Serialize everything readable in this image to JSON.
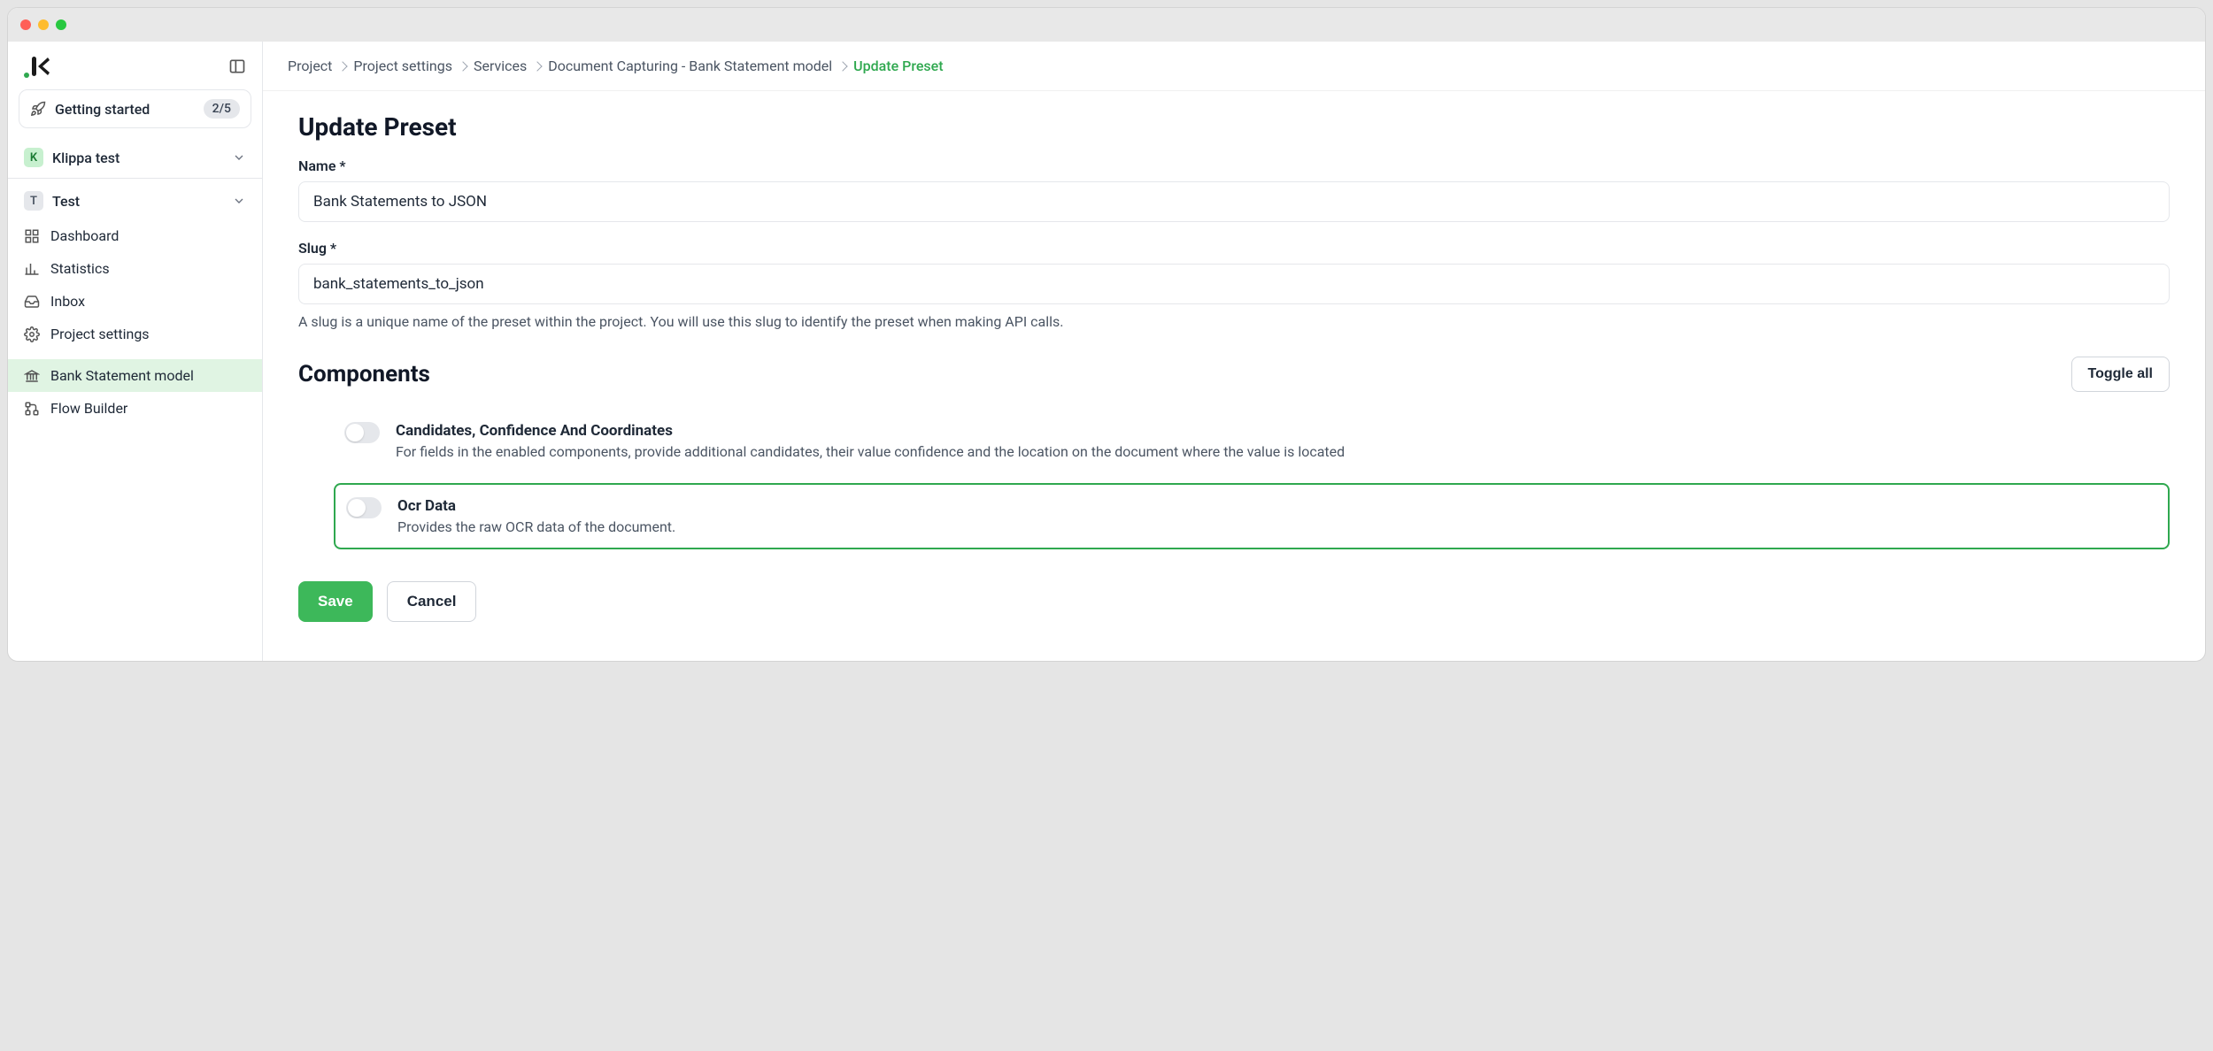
{
  "sidebar": {
    "getting_started": {
      "label": "Getting started",
      "badge": "2/5"
    },
    "org": {
      "initial": "K",
      "name": "Klippa test"
    },
    "project": {
      "initial": "T",
      "name": "Test"
    },
    "nav": {
      "dashboard": "Dashboard",
      "statistics": "Statistics",
      "inbox": "Inbox",
      "project_settings": "Project settings",
      "bank_statement_model": "Bank Statement model",
      "flow_builder": "Flow Builder"
    }
  },
  "breadcrumb": {
    "items": [
      "Project",
      "Project settings",
      "Services",
      "Document Capturing - Bank Statement model",
      "Update Preset"
    ]
  },
  "page": {
    "title": "Update Preset",
    "name_label": "Name *",
    "name_value": "Bank Statements to JSON",
    "slug_label": "Slug *",
    "slug_value": "bank_statements_to_json",
    "slug_help": "A slug is a unique name of the preset within the project. You will use this slug to identify the preset when making API calls.",
    "components_title": "Components",
    "toggle_all_label": "Toggle all",
    "components": [
      {
        "title": "Candidates, Confidence And Coordinates",
        "desc": "For fields in the enabled components, provide additional candidates, their value confidence and the location on the document where the value is located",
        "highlighted": false
      },
      {
        "title": "Ocr Data",
        "desc": "Provides the raw OCR data of the document.",
        "highlighted": true
      }
    ],
    "save_label": "Save",
    "cancel_label": "Cancel"
  }
}
